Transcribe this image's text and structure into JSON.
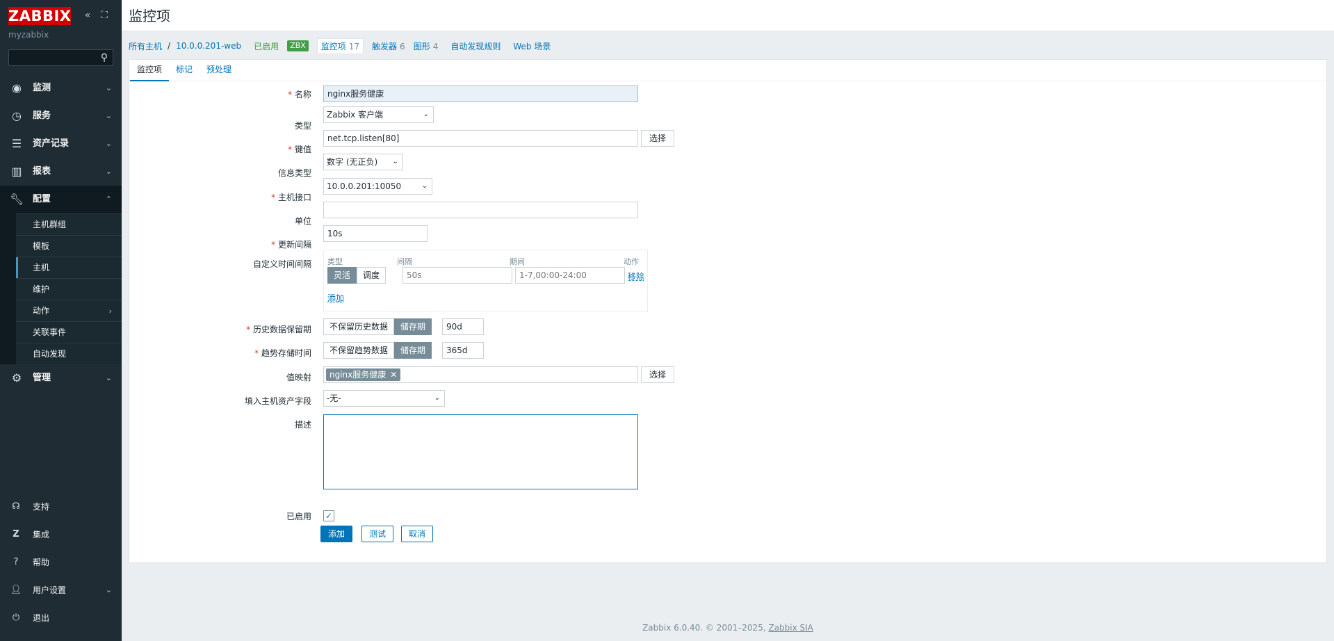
{
  "sidebar": {
    "logo": "ZABBIX",
    "server_name": "myzabbix",
    "search": {
      "value": "",
      "placeholder": ""
    },
    "menu": [
      {
        "label": "监测",
        "icon": "eye-icon"
      },
      {
        "label": "服务",
        "icon": "clock-icon"
      },
      {
        "label": "资产记录",
        "icon": "list-icon"
      },
      {
        "label": "报表",
        "icon": "bar-chart-icon"
      },
      {
        "label": "配置",
        "icon": "wrench-icon"
      }
    ],
    "config_submenu": [
      "主机群组",
      "模板",
      "主机",
      "维护",
      "动作",
      "关联事件",
      "自动发现"
    ],
    "admin": {
      "label": "管理",
      "icon": "gear-icon"
    },
    "bottom": [
      {
        "label": "支持",
        "icon": "headset-icon"
      },
      {
        "label": "集成",
        "icon": "zabbix-z-icon"
      },
      {
        "label": "帮助",
        "icon": "question-icon"
      },
      {
        "label": "用户设置",
        "icon": "user-icon"
      },
      {
        "label": "退出",
        "icon": "power-icon"
      }
    ]
  },
  "header": {
    "title": "监控项"
  },
  "hostnav": {
    "all_hosts": "所有主机",
    "separator": "/",
    "host": "10.0.0.201-web",
    "status": "已启用",
    "zbx": "ZBX",
    "items": {
      "label": "监控项",
      "count": "17"
    },
    "triggers": {
      "label": "触发器",
      "count": "6"
    },
    "graphs": {
      "label": "图形",
      "count": "4"
    },
    "discovery": "自动发现规则",
    "web": "Web 场景"
  },
  "form_tabs": [
    "监控项",
    "标记",
    "预处理"
  ],
  "form": {
    "name": {
      "label": "名称",
      "value": "nginx服务健康"
    },
    "type": {
      "label": "类型",
      "value": "Zabbix 客户端"
    },
    "key": {
      "label": "键值",
      "value": "net.tcp.listen[80]",
      "select_btn": "选择"
    },
    "info_type": {
      "label": "信息类型",
      "value": "数字 (无正负)"
    },
    "host_interface": {
      "label": "主机接口",
      "value": "10.0.0.201:10050"
    },
    "units": {
      "label": "单位",
      "value": ""
    },
    "update_interval": {
      "label": "更新间隔",
      "value": "10s"
    },
    "custom_intervals": {
      "label": "自定义时间间隔",
      "headers": {
        "type": "类型",
        "interval": "间隔",
        "period": "期间",
        "action": "动作"
      },
      "seg_flexible": "灵活",
      "seg_scheduling": "调度",
      "interval_placeholder": "50s",
      "period_placeholder": "1-7,00:00-24:00",
      "remove": "移除",
      "add": "添加"
    },
    "history": {
      "label": "历史数据保留期",
      "opt_no": "不保留历史数据",
      "opt_store": "储存期",
      "value": "90d"
    },
    "trends": {
      "label": "趋势存储时间",
      "opt_no": "不保留趋势数据",
      "opt_store": "储存期",
      "value": "365d"
    },
    "valuemap": {
      "label": "值映射",
      "tag": "nginx服务健康",
      "tag_remove": "✕",
      "select_btn": "选择"
    },
    "inventory": {
      "label": "填入主机资产字段",
      "value": "-无-"
    },
    "description": {
      "label": "描述",
      "value": ""
    },
    "enabled": {
      "label": "已启用",
      "checked": true
    },
    "buttons": {
      "add": "添加",
      "test": "测试",
      "cancel": "取消"
    }
  },
  "footer": {
    "text": "Zabbix 6.0.40. © 2001–2025,",
    "link": "Zabbix SIA"
  },
  "colors": {
    "sidebar_bg": "#1f2c33",
    "brand_red": "#d40000",
    "link": "#0275b8",
    "enabled_green": "#429e47",
    "required": "#e33734"
  }
}
